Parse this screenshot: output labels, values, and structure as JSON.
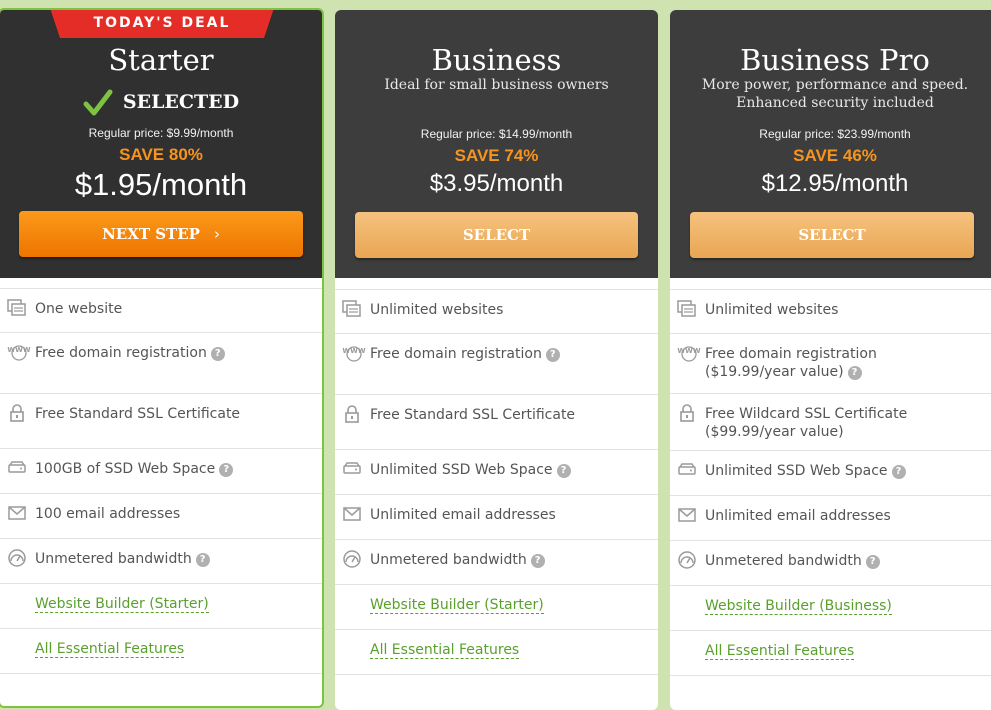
{
  "ribbon": "TODAY'S DEAL",
  "plans": [
    {
      "name": "Starter",
      "selected_label": "SELECTED",
      "regular": "Regular price: $9.99/month",
      "save": "SAVE 80%",
      "price": "$1.95/month",
      "button": "NEXT STEP",
      "features": [
        {
          "icon": "websites-icon",
          "text": "One website",
          "help": false
        },
        {
          "icon": "www-icon",
          "text": "Free domain registration",
          "help": true
        },
        {
          "icon": "lock-icon",
          "text": "Free Standard SSL Certificate",
          "help": false
        },
        {
          "icon": "disk-icon",
          "text": "100GB of SSD Web Space",
          "help": true
        },
        {
          "icon": "email-icon",
          "text": "100 email addresses",
          "help": false
        },
        {
          "icon": "bandwidth-icon",
          "text": "Unmetered bandwidth",
          "help": true
        }
      ],
      "links": [
        "Website Builder (Starter)",
        "All Essential Features"
      ]
    },
    {
      "name": "Business",
      "subtitle": "Ideal for small business owners",
      "regular": "Regular price: $14.99/month",
      "save": "SAVE 74%",
      "price": "$3.95/month",
      "button": "SELECT",
      "features": [
        {
          "icon": "websites-icon",
          "text": "Unlimited websites",
          "help": false
        },
        {
          "icon": "www-icon",
          "text": "Free domain registration",
          "help": true
        },
        {
          "icon": "lock-icon",
          "text": "Free Standard SSL Certificate",
          "help": false
        },
        {
          "icon": "disk-icon",
          "text": "Unlimited SSD Web Space",
          "help": true
        },
        {
          "icon": "email-icon",
          "text": "Unlimited email addresses",
          "help": false
        },
        {
          "icon": "bandwidth-icon",
          "text": "Unmetered bandwidth",
          "help": true
        }
      ],
      "links": [
        "Website Builder (Starter)",
        "All Essential Features"
      ]
    },
    {
      "name": "Business Pro",
      "subtitle": "More power, performance and speed.",
      "subtitle2": "Enhanced security included",
      "regular": "Regular price: $23.99/month",
      "save": "SAVE 46%",
      "price": "$12.95/month",
      "button": "SELECT",
      "features": [
        {
          "icon": "websites-icon",
          "text": "Unlimited websites",
          "help": false
        },
        {
          "icon": "www-icon",
          "text": "Free domain registration",
          "text2": "($19.99/year value)",
          "help": true
        },
        {
          "icon": "lock-icon",
          "text": "Free Wildcard SSL Certificate",
          "text2": "($99.99/year value)",
          "help": false
        },
        {
          "icon": "disk-icon",
          "text": "Unlimited SSD Web Space",
          "help": true
        },
        {
          "icon": "email-icon",
          "text": "Unlimited email addresses",
          "help": false
        },
        {
          "icon": "bandwidth-icon",
          "text": "Unmetered bandwidth",
          "help": true
        }
      ],
      "links": [
        "Website Builder (Business)",
        "All Essential Features"
      ]
    }
  ],
  "colors": {
    "accent": "#f7941d",
    "selected_border": "#7dc242",
    "link": "#5aa02c",
    "ribbon": "#e52d27"
  }
}
